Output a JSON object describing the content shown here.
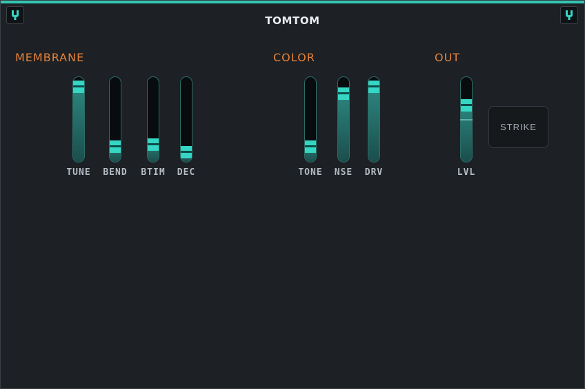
{
  "title": "TOMTOM",
  "accent_color": "#33c6b4",
  "section_color": "#e5833a",
  "corner_buttons": [
    {
      "icon": "tuning-fork-icon"
    },
    {
      "icon": "tuning-fork-icon"
    }
  ],
  "sections": {
    "membrane": "MEMBRANE",
    "color": "COLOR",
    "out": "OUT"
  },
  "sliders": [
    {
      "id": "tune",
      "label": "TUNE",
      "value": 0.95
    },
    {
      "id": "bend",
      "label": "BEND",
      "value": 0.12
    },
    {
      "id": "btim",
      "label": "BTIM",
      "value": 0.15
    },
    {
      "id": "dec",
      "label": "DEC",
      "value": 0.05
    },
    {
      "id": "tone",
      "label": "TONE",
      "value": 0.12
    },
    {
      "id": "nse",
      "label": "NSE",
      "value": 0.86
    },
    {
      "id": "drv",
      "label": "DRV",
      "value": 0.95
    },
    {
      "id": "lvl",
      "label": "LVL",
      "value": 0.7
    }
  ],
  "strike_button": "STRIKE"
}
